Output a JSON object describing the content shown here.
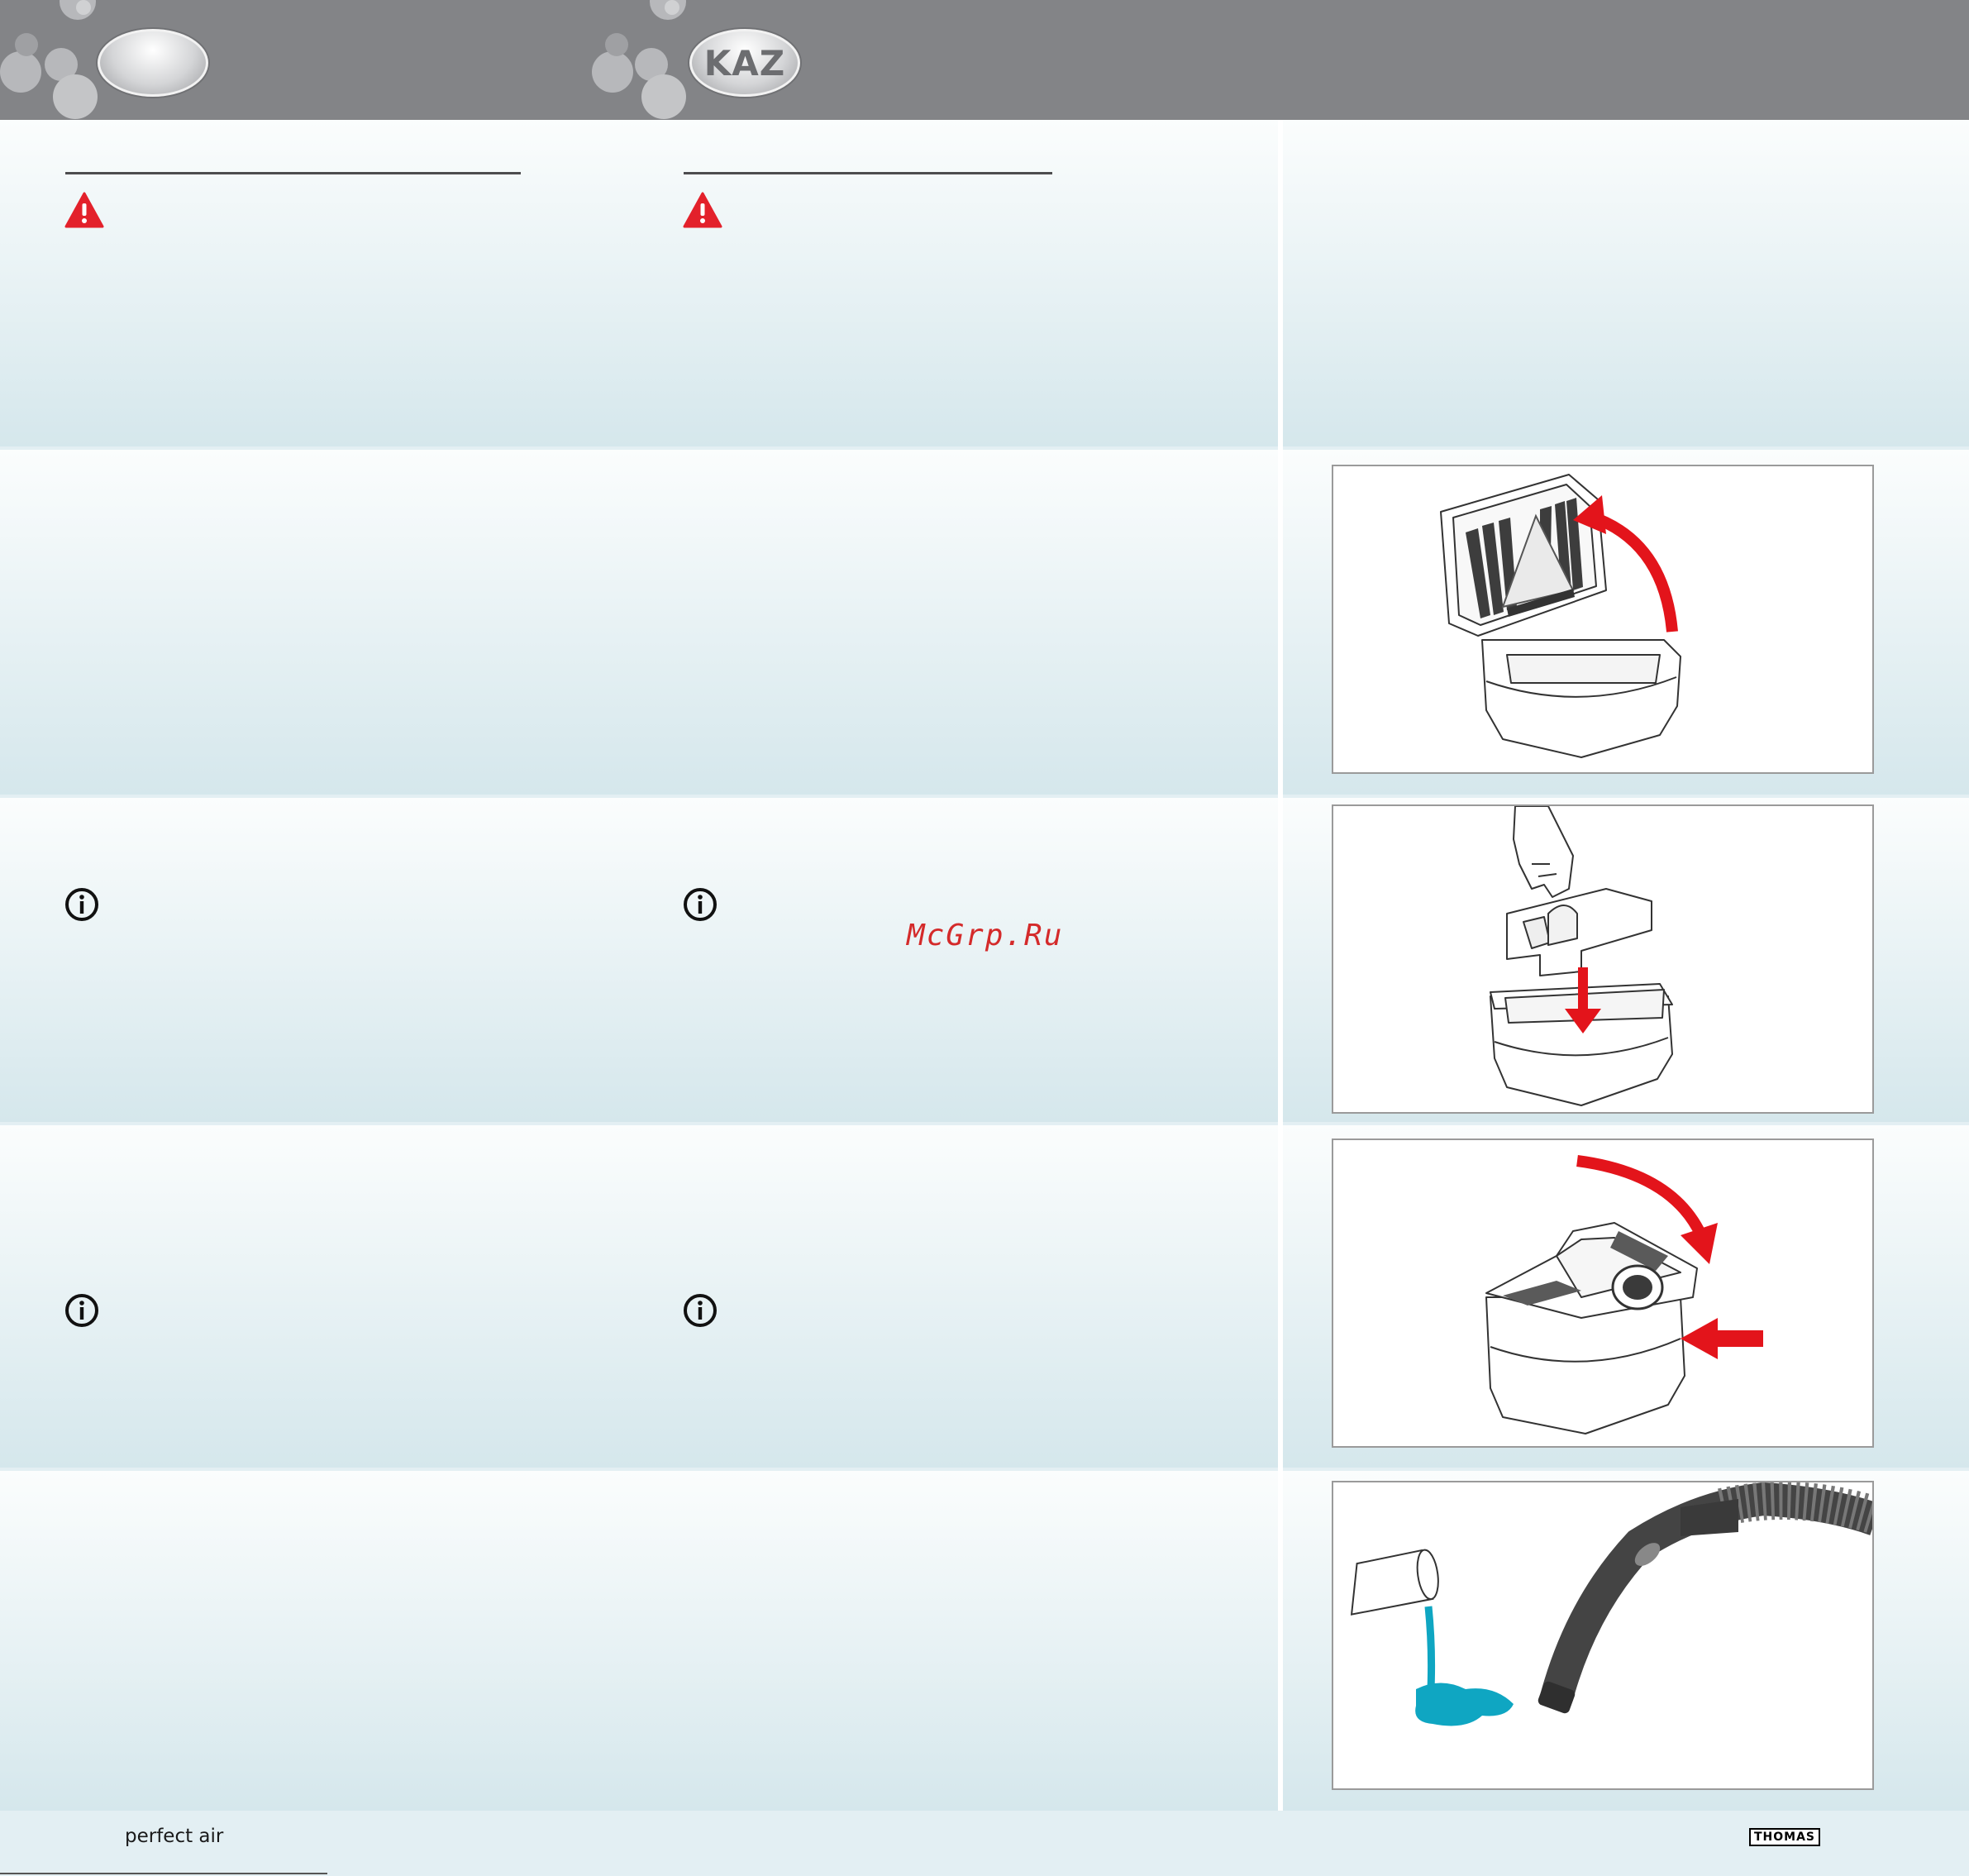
{
  "header": {
    "left_badge_text": "",
    "right_badge_text": "KAZ"
  },
  "watermark": "McGrp.Ru",
  "footer": {
    "left_text": "perfect air",
    "right_logo_text": "THOMAS"
  },
  "icons": {
    "warning": "warning-triangle-icon",
    "info": "info-circle-icon"
  },
  "colors": {
    "header_band": "#838487",
    "warning_red": "#e3212b",
    "arrow_red": "#e3141b",
    "water": "#0fa6c2"
  },
  "figures": [
    {
      "description_name": "open-filter-lid-figure"
    },
    {
      "description_name": "insert-filter-figure"
    },
    {
      "description_name": "close-lid-figure"
    },
    {
      "description_name": "pour-water-hose-figure"
    }
  ]
}
